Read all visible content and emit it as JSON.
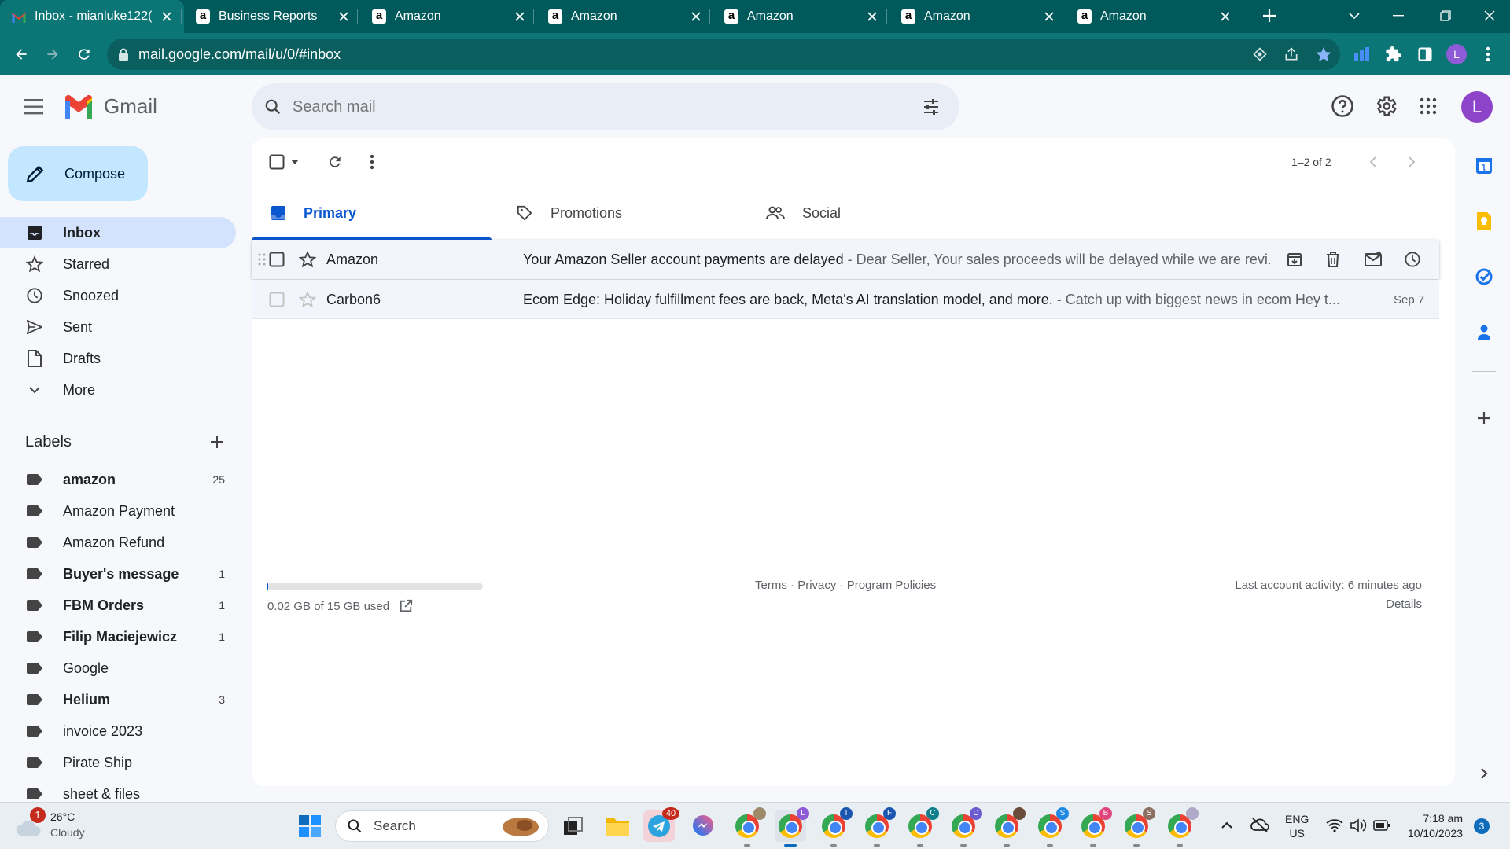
{
  "browser": {
    "tabs": [
      {
        "title": "Inbox - mianluke122(",
        "active": true,
        "favicon": "gmail-icon"
      },
      {
        "title": "Business Reports",
        "active": false,
        "favicon": "amazon-icon"
      },
      {
        "title": "Amazon",
        "active": false,
        "favicon": "amazon-icon"
      },
      {
        "title": "Amazon",
        "active": false,
        "favicon": "amazon-icon"
      },
      {
        "title": "Amazon",
        "active": false,
        "favicon": "amazon-icon"
      },
      {
        "title": "Amazon",
        "active": false,
        "favicon": "amazon-icon"
      },
      {
        "title": "Amazon",
        "active": false,
        "favicon": "amazon-icon"
      }
    ],
    "url": "mail.google.com/mail/u/0/#inbox",
    "profile_initial": "L"
  },
  "gmail": {
    "brand": "Gmail",
    "search_placeholder": "Search mail",
    "avatar_initial": "L",
    "compose_label": "Compose",
    "nav": [
      {
        "label": "Inbox",
        "icon": "inbox-icon"
      },
      {
        "label": "Starred",
        "icon": "star-icon"
      },
      {
        "label": "Snoozed",
        "icon": "clock-icon"
      },
      {
        "label": "Sent",
        "icon": "send-icon"
      },
      {
        "label": "Drafts",
        "icon": "draft-icon"
      },
      {
        "label": "More",
        "icon": "chevron-down-icon"
      }
    ],
    "labels_heading": "Labels",
    "labels": [
      {
        "name": "amazon",
        "count": "25",
        "bold": true
      },
      {
        "name": "Amazon Payment",
        "count": "",
        "bold": false
      },
      {
        "name": "Amazon Refund",
        "count": "",
        "bold": false
      },
      {
        "name": "Buyer's message",
        "count": "1",
        "bold": true
      },
      {
        "name": "FBM Orders",
        "count": "1",
        "bold": true
      },
      {
        "name": "Filip Maciejewicz",
        "count": "1",
        "bold": true
      },
      {
        "name": "Google",
        "count": "",
        "bold": false
      },
      {
        "name": "Helium",
        "count": "3",
        "bold": true
      },
      {
        "name": "invoice 2023",
        "count": "",
        "bold": false
      },
      {
        "name": "Pirate Ship",
        "count": "",
        "bold": false
      },
      {
        "name": "sheet & files",
        "count": "",
        "bold": false
      }
    ],
    "pagination": "1–2 of 2",
    "categories": [
      {
        "label": "Primary",
        "icon": "inbox-icon"
      },
      {
        "label": "Promotions",
        "icon": "tag-icon"
      },
      {
        "label": "Social",
        "icon": "people-icon"
      }
    ],
    "emails": [
      {
        "sender": "Amazon",
        "subject": "Your Amazon Seller account payments are delayed",
        "snippet": " - Dear Seller, Your sales proceeds will be delayed while we are revi...",
        "date": ""
      },
      {
        "sender": "Carbon6",
        "subject": "Ecom Edge: Holiday fulfillment fees are back, Meta's AI translation model, and more.",
        "snippet": " - Catch up with biggest news in ecom Hey t...",
        "date": "Sep 7"
      }
    ],
    "footer": {
      "storage": "0.02 GB of 15 GB used",
      "storage_used_fraction": 0.0013,
      "terms": "Terms",
      "privacy": "Privacy",
      "policies": "Program Policies",
      "sep": "·",
      "last_activity": "Last account activity: 6 minutes ago",
      "details": "Details"
    }
  },
  "taskbar": {
    "weather_temp": "26°C",
    "weather_desc": "Cloudy",
    "weather_badge": "1",
    "search_label": "Search",
    "telegram_badge": "40",
    "chrome_profiles": [
      {
        "letter": "",
        "color": "#9c8a6a"
      },
      {
        "letter": "L",
        "color": "#8e5bd6"
      },
      {
        "letter": "I",
        "color": "#1a56b0"
      },
      {
        "letter": "F",
        "color": "#1a56b0"
      },
      {
        "letter": "C",
        "color": "#0f7d8a"
      },
      {
        "letter": "D",
        "color": "#6a5acd"
      },
      {
        "letter": "",
        "color": "#6b4b3b"
      },
      {
        "letter": "S",
        "color": "#1e88e5"
      },
      {
        "letter": "B",
        "color": "#e0457b"
      },
      {
        "letter": "S",
        "color": "#8d6e63"
      },
      {
        "letter": "",
        "color": "#b0a8c8"
      }
    ],
    "lang": "ENG",
    "region": "US",
    "time": "7:18 am",
    "date": "10/10/2023",
    "notif_count": "3"
  }
}
